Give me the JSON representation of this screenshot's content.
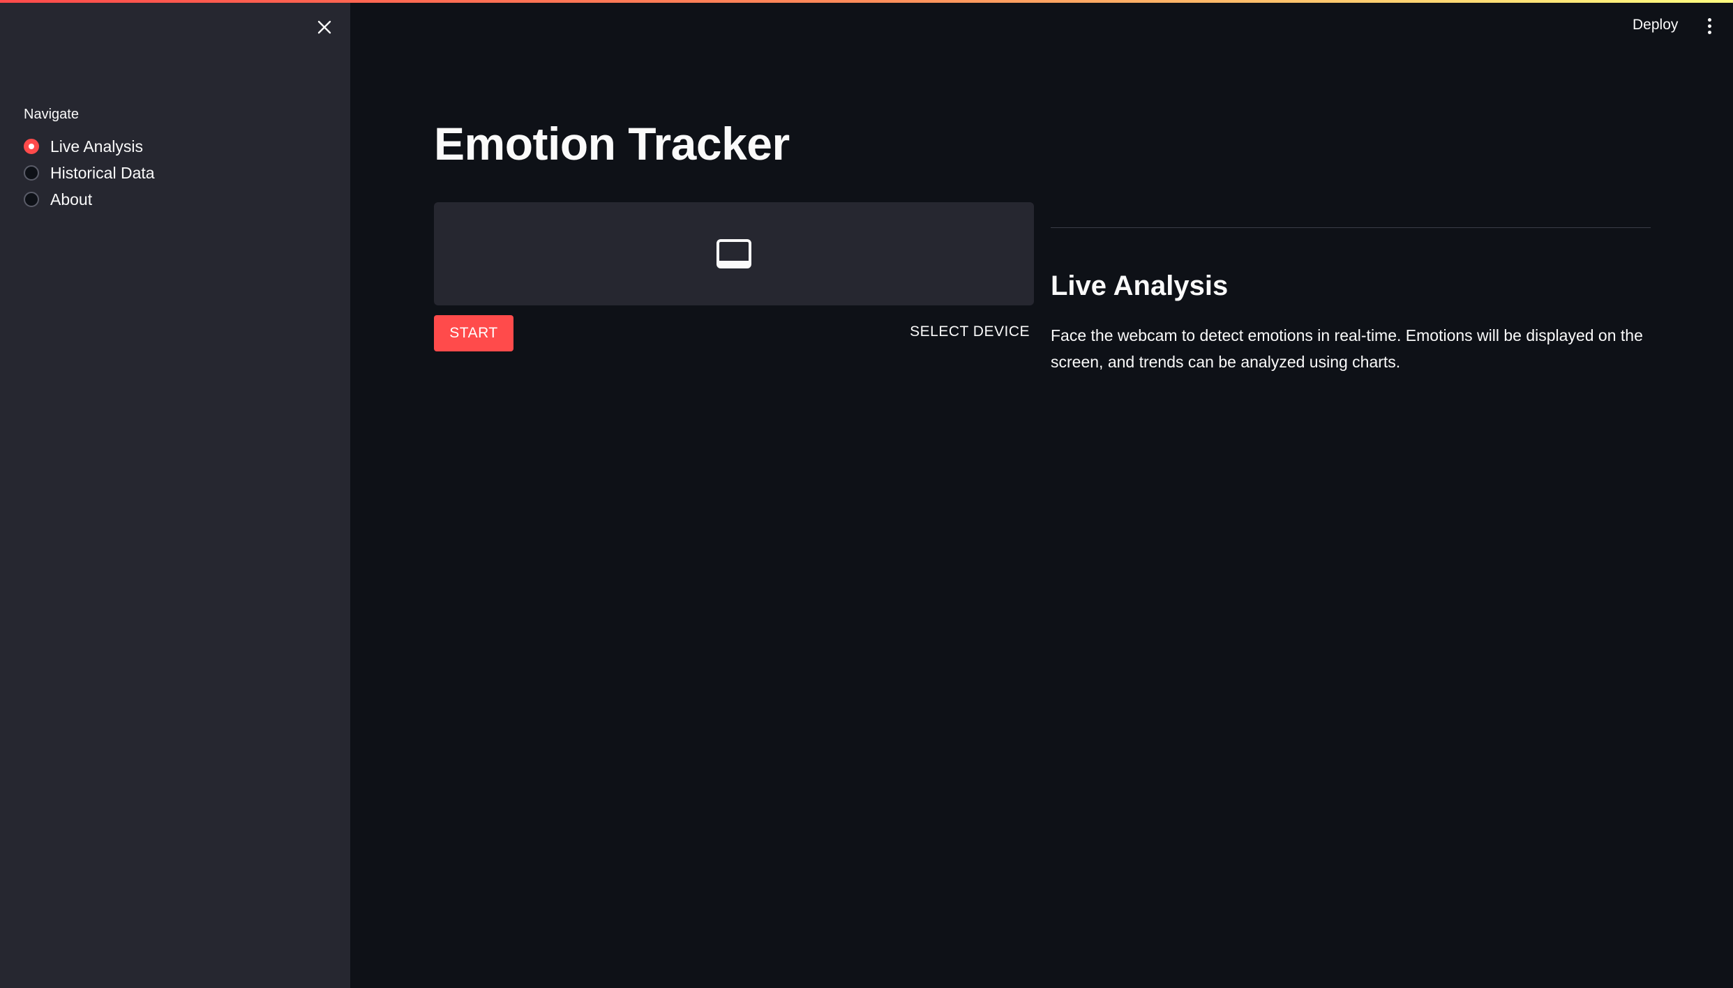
{
  "colors": {
    "accent": "#ff4b4b",
    "sidebar_bg": "#262730",
    "main_bg": "#0e1117"
  },
  "sidebar": {
    "close_icon": "close-icon",
    "nav_label": "Navigate",
    "options": [
      {
        "label": "Live Analysis",
        "selected": true
      },
      {
        "label": "Historical Data",
        "selected": false
      },
      {
        "label": "About",
        "selected": false
      }
    ]
  },
  "header": {
    "deploy_label": "Deploy",
    "menu_icon": "kebab-menu-icon"
  },
  "main": {
    "title": "Emotion Tracker",
    "webcam": {
      "icon": "video-display-icon",
      "start_label": "START",
      "select_device_label": "SELECT DEVICE"
    },
    "section": {
      "heading": "Live Analysis",
      "description": "Face the webcam to detect emotions in real-time. Emotions will be displayed on the screen, and trends can be analyzed using charts."
    }
  }
}
